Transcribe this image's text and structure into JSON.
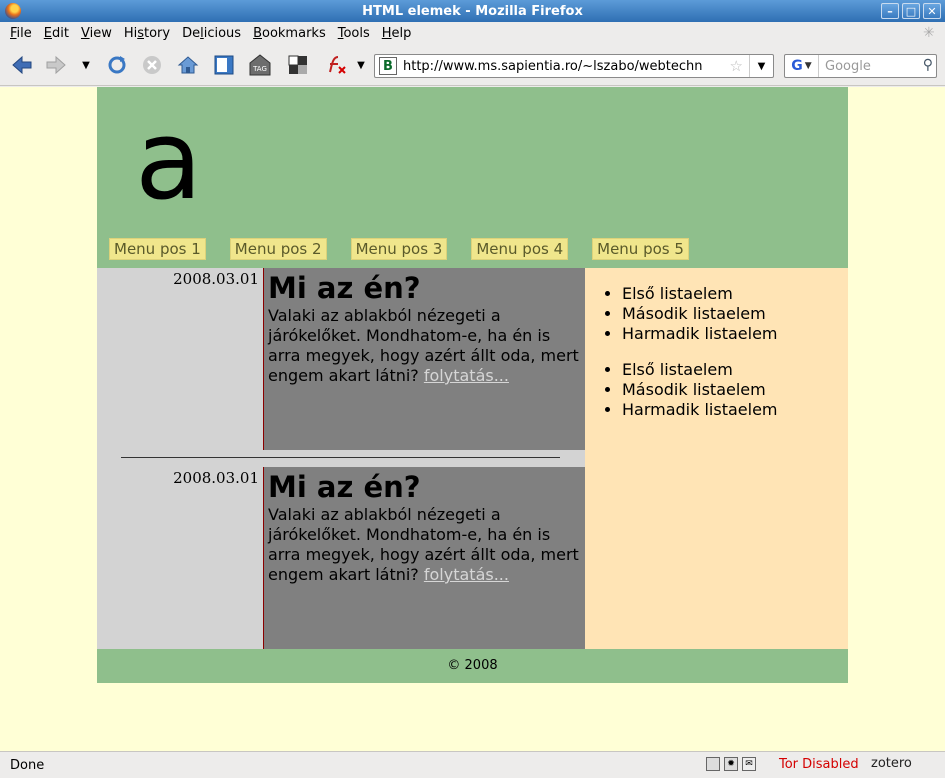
{
  "window": {
    "title": "HTML elemek - Mozilla Firefox"
  },
  "menubar": {
    "items": [
      {
        "ul": "F",
        "rest": "ile"
      },
      {
        "ul": "E",
        "rest": "dit"
      },
      {
        "ul": "V",
        "rest": "iew"
      },
      {
        "ul": "",
        "pre": "Hi",
        "mid": "s",
        "post": "tory"
      },
      {
        "ul": "",
        "pre": "De",
        "mid": "l",
        "post": "icious"
      },
      {
        "ul": "B",
        "rest": "ookmarks"
      },
      {
        "ul": "T",
        "rest": "ools"
      },
      {
        "ul": "H",
        "rest": "elp"
      }
    ],
    "labels": [
      "File",
      "Edit",
      "View",
      "History",
      "Delicious",
      "Bookmarks",
      "Tools",
      "Help"
    ]
  },
  "navbar": {
    "url": "http://www.ms.sapientia.ro/~lszabo/webtechnolo",
    "site_icon_letter": "B",
    "search_placeholder": "Google",
    "search_engine_letter": "G"
  },
  "page": {
    "logo": "a",
    "menu": [
      "Menu pos 1",
      "Menu pos 2",
      "Menu pos 3",
      "Menu pos 4",
      "Menu pos 5"
    ],
    "posts": [
      {
        "date": "2008.03.01",
        "title": "Mi az én?",
        "text": "Valaki az ablakból nézegeti a járókelőket. Mondhatom-e, ha én is arra megyek, hogy azért állt oda, mert engem akart látni? ",
        "link": "folytatás..."
      },
      {
        "date": "2008.03.01",
        "title": "Mi az én?",
        "text": "Valaki az ablakból nézegeti a járókelőket. Mondhatom-e, ha én is arra megyek, hogy azért állt oda, mert engem akart látni? ",
        "link": "folytatás..."
      }
    ],
    "sidebar_lists": [
      [
        "Első listaelem",
        "Második listaelem",
        "Harmadik listaelem"
      ],
      [
        "Első listaelem",
        "Második listaelem",
        "Harmadik listaelem"
      ]
    ],
    "footer": "© 2008"
  },
  "statusbar": {
    "status": "Done",
    "tor": "Tor Disabled",
    "zotero": "zotero"
  },
  "colors": {
    "header_bg": "#8fbf8c",
    "menu_link_bg": "#f0e68c",
    "content_bg": "#ffffd6",
    "left_col_bg": "#d3d3d3",
    "post_body_bg": "#808080",
    "sidebar_bg": "#ffe4b5"
  }
}
